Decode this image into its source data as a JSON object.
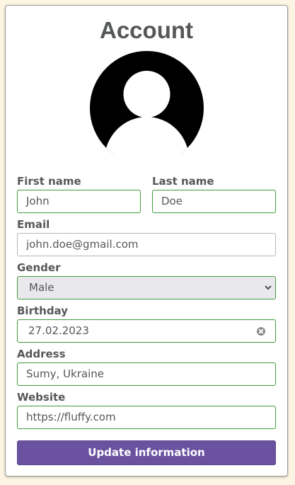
{
  "header": {
    "title": "Account"
  },
  "avatar": {
    "icon": "user-avatar-icon"
  },
  "form": {
    "first_name": {
      "label": "First name",
      "value": "John"
    },
    "last_name": {
      "label": "Last name",
      "value": "Doe"
    },
    "email": {
      "label": "Email",
      "value": "john.doe@gmail.com"
    },
    "gender": {
      "label": "Gender",
      "value": "Male"
    },
    "birthday": {
      "label": "Birthday",
      "value": "27.02.2023"
    },
    "address": {
      "label": "Address",
      "value": "Sumy, Ukraine"
    },
    "website": {
      "label": "Website",
      "value": "https://fluffy.com"
    },
    "submit_label": "Update information"
  },
  "colors": {
    "page_background": "#fdf5e2",
    "valid_border": "#3f9a3a",
    "button": "#6a52a0",
    "text": "#555759"
  }
}
